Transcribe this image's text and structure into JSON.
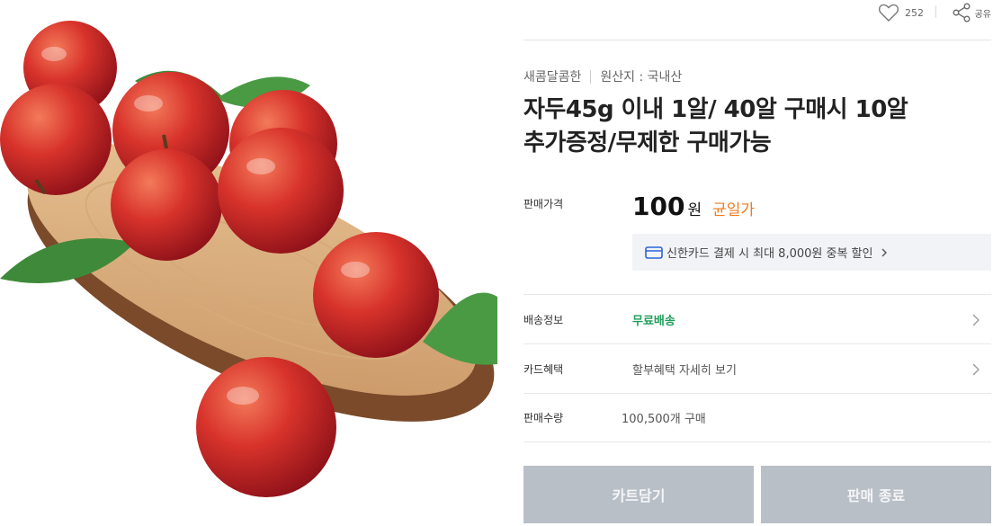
{
  "product": {
    "image_alt": "plums on a wooden slab with leaves"
  },
  "actions": {
    "like_count": "252",
    "share_label": "공유"
  },
  "meta": {
    "seller": "새콤달콤한",
    "origin": "원산지 : 국내산"
  },
  "title": {
    "line1": "자두45g 이내 1알/ 40알 구매시 10알",
    "line2": "추가증정/무제한 구매가능"
  },
  "price": {
    "label": "판매가격",
    "amount": "100",
    "unit": "원",
    "tag": "균일가"
  },
  "promo": {
    "text": "신한카드 결제 시 최대 8,000원 중복 할인"
  },
  "details": {
    "shipping_label": "배송정보",
    "shipping_value": "무료배송",
    "card_label": "카드혜택",
    "card_value": "할부혜택 자세히 보기",
    "sales_label": "판매수량",
    "sales_value": "100,500개 구매"
  },
  "buttons": {
    "cart": "카트담기",
    "closed": "판매 종료"
  },
  "colors": {
    "accent_orange": "#f07a1c",
    "shipping_green": "#1f9e5a",
    "disabled_button": "#b9bfc7",
    "promo_bg": "#f2f3f6"
  },
  "icons": [
    "heart-icon",
    "share-icon",
    "credit-card-icon",
    "chevron-right-icon"
  ]
}
